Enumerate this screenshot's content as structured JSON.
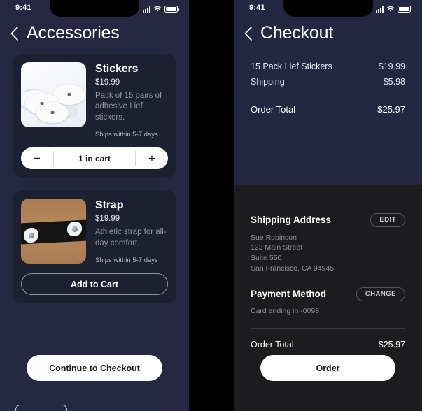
{
  "status_bar": {
    "time": "9:41",
    "icons": [
      "signal-icon",
      "wifi-icon",
      "battery-icon"
    ]
  },
  "left_screen": {
    "nav": {
      "back_icon": "chevron-left-icon",
      "title": "Accessories"
    },
    "products": [
      {
        "name": "Stickers",
        "price": "$19.99",
        "description": "Pack of 15 pairs of adhesive Lief stickers.",
        "shipping": "Ships within 5-7 days",
        "image_alt": "white-adhesive-stickers-photo",
        "stepper": {
          "decrement": "−",
          "label": "1 in cart",
          "increment": "+"
        }
      },
      {
        "name": "Strap",
        "price": "$19.99",
        "description": "Athletic strap for all-day comfort.",
        "shipping": "Ships within 5-7 days",
        "image_alt": "black-athletic-strap-photo",
        "action_label": "Add to Cart"
      }
    ],
    "continue_label": "Continue to Checkout"
  },
  "right_screen": {
    "nav": {
      "back_icon": "chevron-left-icon",
      "title": "Checkout"
    },
    "summary": {
      "rows": [
        {
          "label": "15 Pack Lief Stickers",
          "amount": "$19.99"
        },
        {
          "label": "Shipping",
          "amount": "$5.98"
        }
      ],
      "total_label": "Order Total",
      "total_amount": "$25.97"
    },
    "shipping": {
      "title": "Shipping Address",
      "edit_label": "EDIT",
      "lines": [
        "Sue Robinson",
        "123 Main Street",
        "Suite 550",
        "San Francisco, CA 94945"
      ]
    },
    "payment": {
      "title": "Payment Method",
      "change_label": "CHANGE",
      "detail": "Card ending in -0098"
    },
    "final_total": {
      "label": "Order Total",
      "amount": "$25.97"
    },
    "order_label": "Order"
  },
  "colors": {
    "gutter": "#000000",
    "left_bg": "#252840",
    "right_top_bg": "#242741",
    "right_bottom_bg": "#1c1c1e",
    "card_bg": "#1d2031",
    "accent_white": "#ffffff",
    "muted_text": "#9095a8"
  }
}
